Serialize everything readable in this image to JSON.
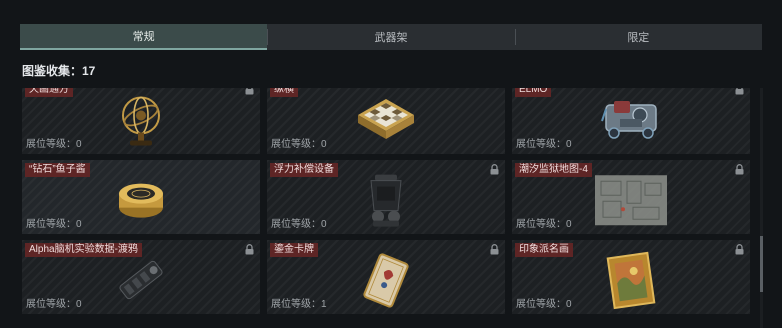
{
  "tabs": [
    {
      "label": "常规",
      "active": true
    },
    {
      "label": "武器架",
      "active": false
    },
    {
      "label": "限定",
      "active": false
    }
  ],
  "collection": {
    "label": "图鉴收集：17"
  },
  "lock_icon": "lock-icon",
  "colors": {
    "label_bg": "#5e2525",
    "active_tab": "#3b4b4a",
    "accent": "#7fa6a0"
  },
  "items": [
    {
      "name": "天画通方",
      "level": "展位等级：0",
      "locked": true,
      "icon": "armillary-sphere-icon"
    },
    {
      "name": "纵横",
      "level": "展位等级：0",
      "locked": false,
      "icon": "chessboard-icon"
    },
    {
      "name": "ELMO",
      "level": "展位等级：0",
      "locked": true,
      "icon": "robot-toy-icon"
    },
    {
      "name": "“钻石”鱼子酱",
      "level": "展位等级：0",
      "locked": false,
      "icon": "caviar-tin-icon"
    },
    {
      "name": "浮力补偿设备",
      "level": "展位等级：0",
      "locked": true,
      "icon": "diving-gear-icon"
    },
    {
      "name": "潮汐监狱地图-4",
      "level": "展位等级：0",
      "locked": true,
      "icon": "map-icon"
    },
    {
      "name": "Alpha脑机实验数据-渡鸦",
      "level": "展位等级：0",
      "locked": true,
      "icon": "data-device-icon"
    },
    {
      "name": "鎏金卡牌",
      "level": "展位等级：1",
      "locked": true,
      "icon": "gilded-card-icon"
    },
    {
      "name": "印象派名画",
      "level": "展位等级：0",
      "locked": true,
      "icon": "framed-painting-icon"
    }
  ]
}
